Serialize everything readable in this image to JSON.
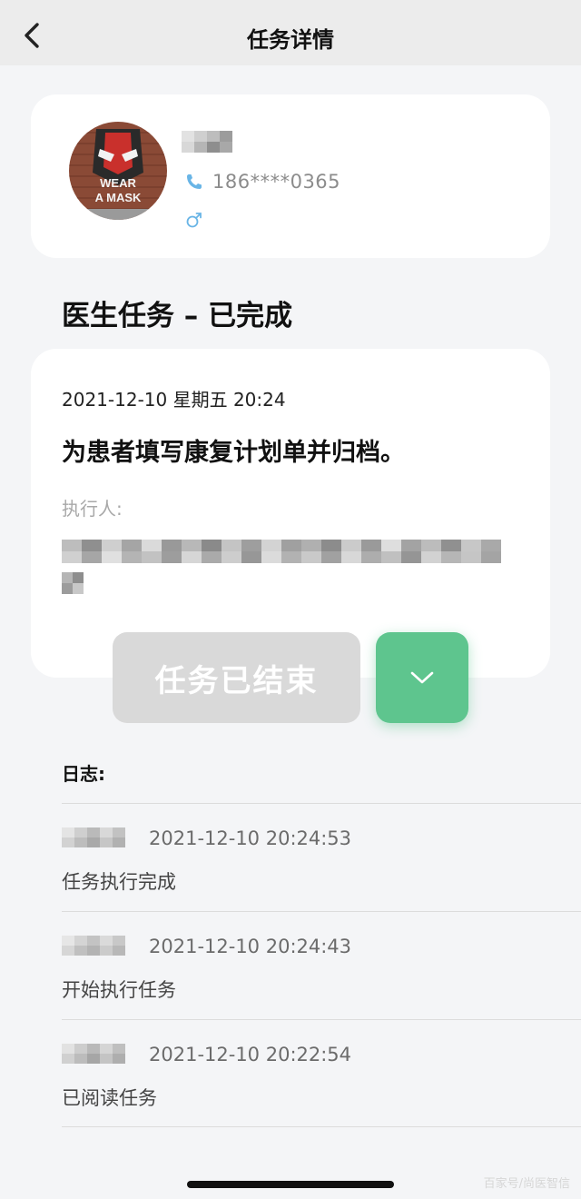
{
  "nav": {
    "title": "任务详情",
    "back_icon": "chevron-left-icon"
  },
  "patient": {
    "phone": "186****0365",
    "phone_icon": "phone-icon",
    "gender_icon": "male-icon",
    "avatar_text": [
      "WEAR",
      "A MASK"
    ]
  },
  "section": {
    "title": "医生任务 – 已完成"
  },
  "task": {
    "datetime": "2021-12-10 星期五 20:24",
    "description": "为患者填写康复计划单并归档。",
    "executor_label": "执行人:"
  },
  "actions": {
    "ended_label": "任务已结束",
    "expand_icon": "chevron-down-icon",
    "accent_color": "#5ec58e"
  },
  "log": {
    "title": "日志:",
    "entries": [
      {
        "time": "2021-12-10 20:24:53",
        "action": "任务执行完成"
      },
      {
        "time": "2021-12-10 20:24:43",
        "action": "开始执行任务"
      },
      {
        "time": "2021-12-10 20:22:54",
        "action": "已阅读任务"
      }
    ]
  },
  "watermark": "百家号/尚医智信"
}
